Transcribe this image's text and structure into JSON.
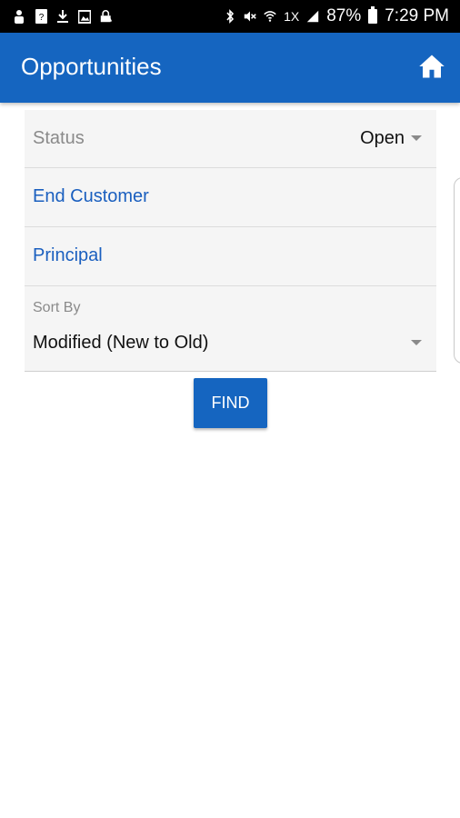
{
  "status_bar": {
    "battery": "87%",
    "time": "7:29 PM",
    "network_type": "1X",
    "left_icons": [
      "person-icon",
      "question-file-icon",
      "download-icon",
      "image-icon",
      "lock-icon"
    ],
    "right_icons": [
      "bluetooth-icon",
      "mute-icon",
      "wifi-icon",
      "signal-icon",
      "battery-icon"
    ]
  },
  "app_bar": {
    "title": "Opportunities",
    "home_icon": "home-icon"
  },
  "form": {
    "status": {
      "label": "Status",
      "value": "Open"
    },
    "end_customer": {
      "label": "End Customer"
    },
    "principal": {
      "label": "Principal"
    },
    "sort_by": {
      "label": "Sort By",
      "value": "Modified (New to Old)"
    }
  },
  "actions": {
    "find_label": "FIND"
  },
  "colors": {
    "primary": "#1565c0",
    "link": "#1a5fbf",
    "form_bg": "#f5f5f5"
  }
}
